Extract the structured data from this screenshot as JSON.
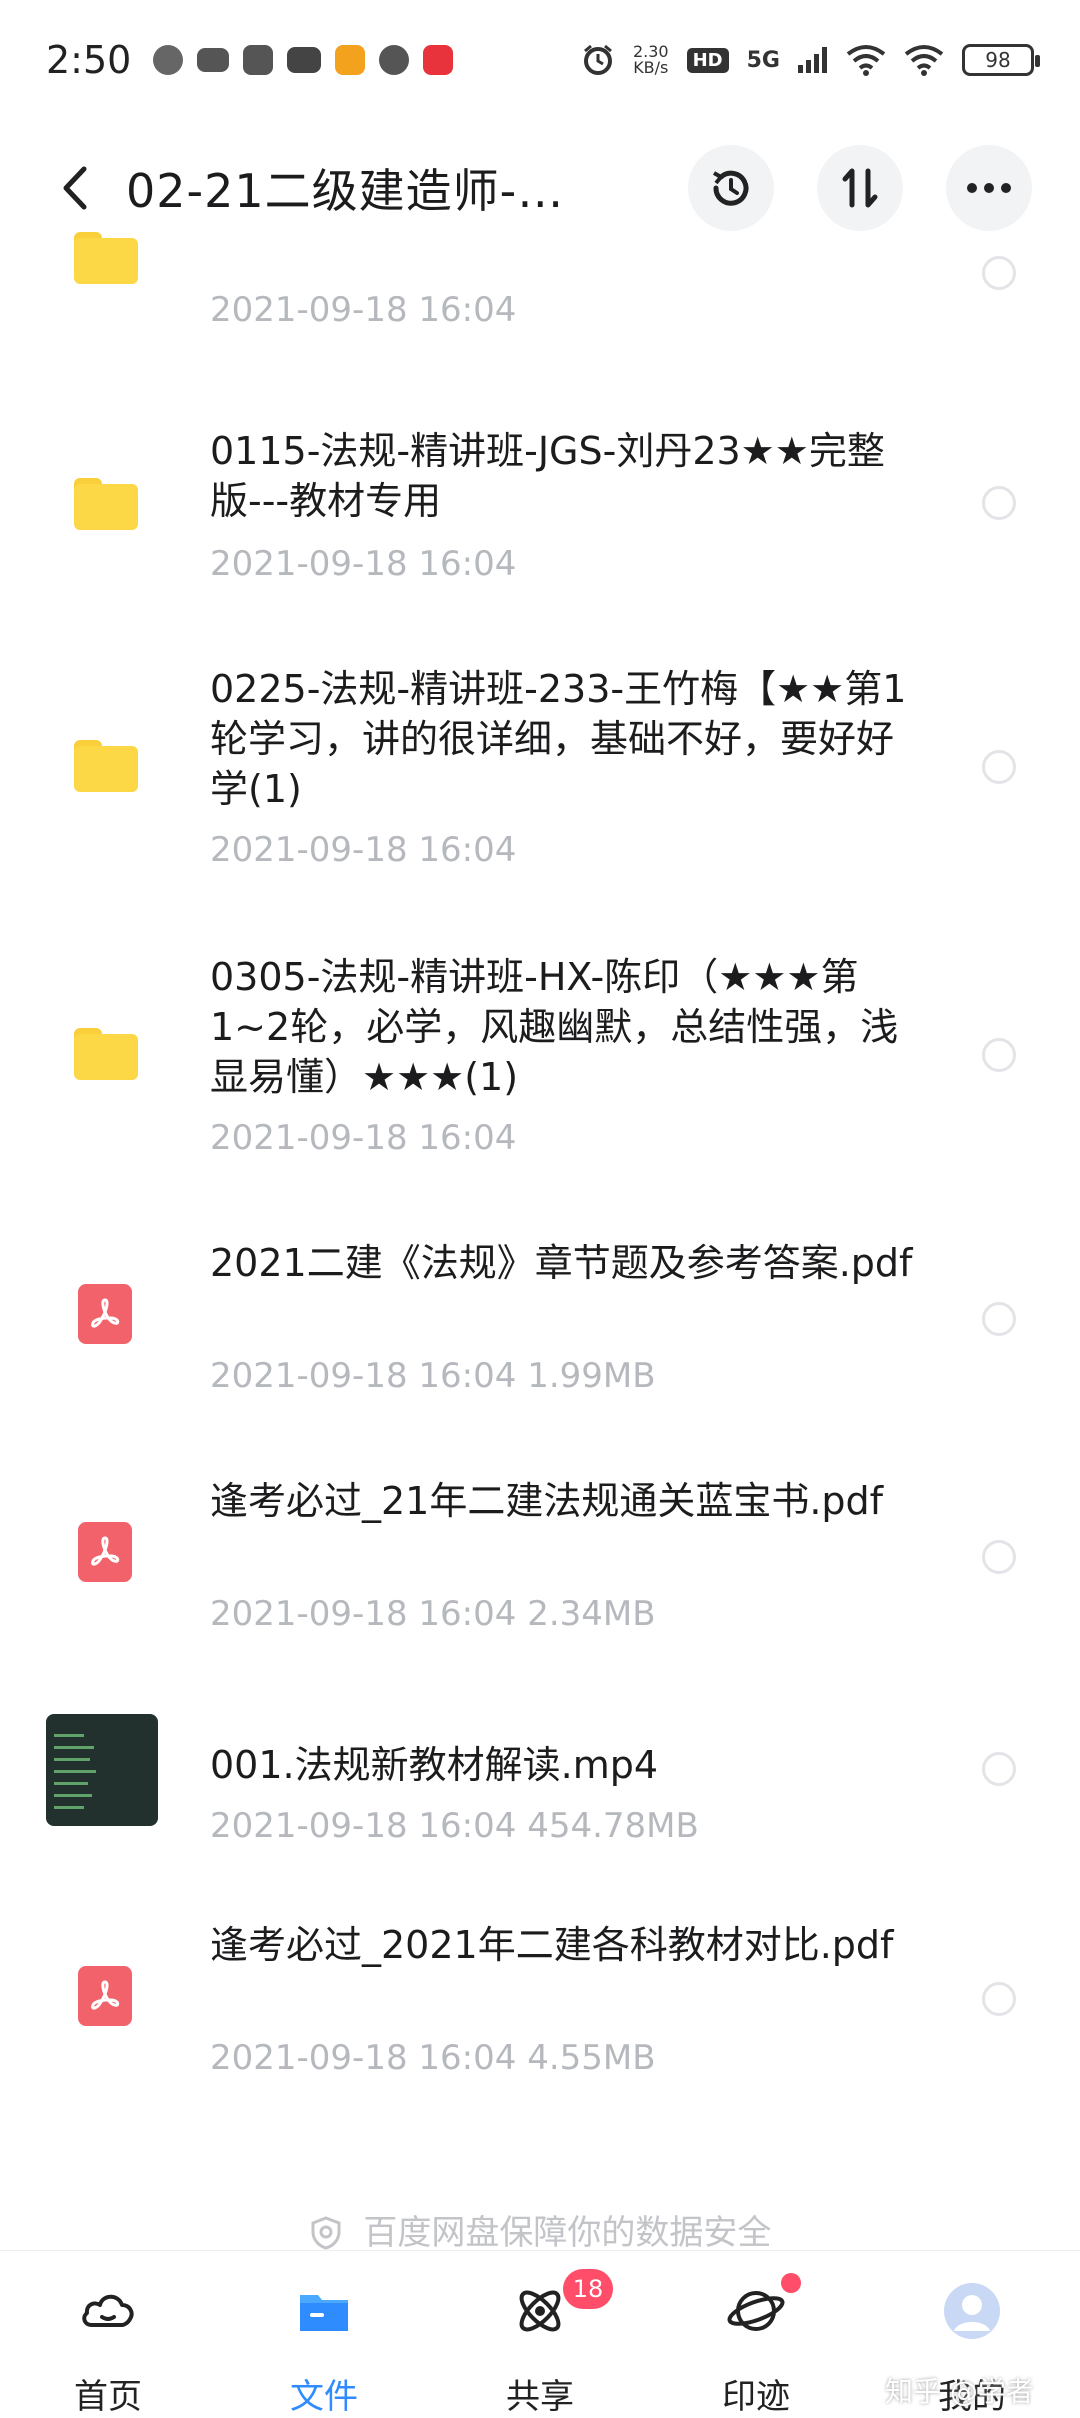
{
  "status_bar": {
    "time": "2:50",
    "net_speed_value": "2.30",
    "net_speed_unit": "KB/s",
    "hd_label": "HD",
    "network_label": "5G",
    "battery": "98"
  },
  "header": {
    "title": "02-21二级建造师-…"
  },
  "files": [
    {
      "type": "folder",
      "title": "",
      "meta": "2021-09-18  16:04"
    },
    {
      "type": "folder",
      "title": "0115-法规-精讲班-JGS-刘丹23★★完整版---教材专用",
      "meta": "2021-09-18  16:04"
    },
    {
      "type": "folder",
      "title": "0225-法规-精讲班-233-王竹梅【★★第1轮学习，讲的很详细，基础不好，要好好学(1)",
      "meta": "2021-09-18  16:04"
    },
    {
      "type": "folder",
      "title": "0305-法规-精讲班-HX-陈印（★★★第1~2轮，必学，风趣幽默，总结性强，浅显易懂）★★★(1)",
      "meta": "2021-09-18  16:04"
    },
    {
      "type": "pdf",
      "title": "2021二建《法规》章节题及参考答案.pdf",
      "meta": "2021-09-18  16:04  1.99MB"
    },
    {
      "type": "pdf",
      "title": "逢考必过_21年二建法规通关蓝宝书.pdf",
      "meta": "2021-09-18  16:04  2.34MB"
    },
    {
      "type": "video",
      "title": "001.法规新教材解读.mp4",
      "meta": "2021-09-18  16:04  454.78MB"
    },
    {
      "type": "pdf",
      "title": "逢考必过_2021年二建各科教材对比.pdf",
      "meta": "2021-09-18  16:04  4.55MB"
    }
  ],
  "footer_note": "百度网盘保障你的数据安全",
  "bottom_nav": [
    {
      "label": "首页",
      "icon": "home-cloud-icon"
    },
    {
      "label": "文件",
      "icon": "folder-icon",
      "active": true
    },
    {
      "label": "共享",
      "icon": "share-atom-icon",
      "badge": "18"
    },
    {
      "label": "印迹",
      "icon": "planet-icon",
      "dot": true
    },
    {
      "label": "我的",
      "icon": "avatar-icon"
    }
  ],
  "watermark": "知乎 @学者"
}
